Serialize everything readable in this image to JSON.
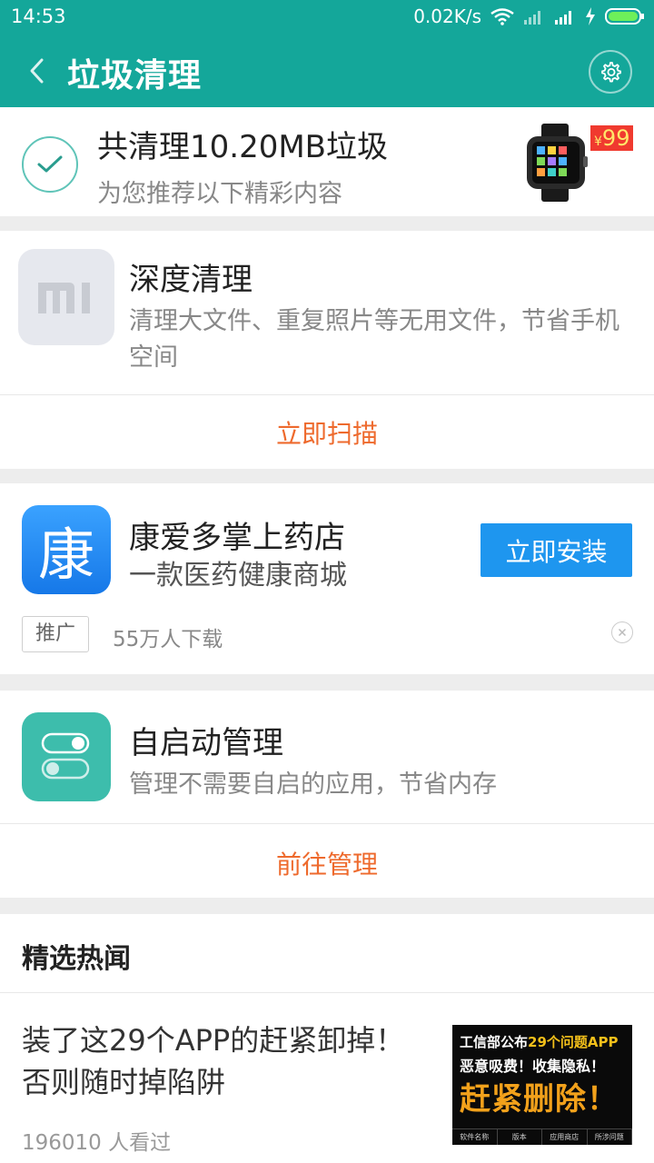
{
  "status_bar": {
    "time": "14:53",
    "net_speed": "0.02K/s"
  },
  "app_bar": {
    "title": "垃圾清理",
    "back_icon": "chevron-left-icon",
    "settings_icon": "gear-icon"
  },
  "summary": {
    "title": "共清理10.20MB垃圾",
    "subtitle": "为您推荐以下精彩内容",
    "ad_price_symbol": "¥",
    "ad_price": "99"
  },
  "deep_clean": {
    "title": "深度清理",
    "description": "清理大文件、重复照片等无用文件，节省手机空间",
    "action": "立即扫描"
  },
  "ad_app": {
    "icon_char": "康",
    "name": "康爱多掌上药店",
    "tagline": "一款医药健康商城",
    "install_label": "立即安装",
    "tag": "推广",
    "downloads": "55万人下载"
  },
  "autostart": {
    "title": "自启动管理",
    "description": "管理不需要自启的应用，节省内存",
    "action": "前往管理"
  },
  "news": {
    "section_title": "精选热闻",
    "item_title": "装了这29个APP的赶紧卸掉！否则随时掉陷阱",
    "item_views": "196010 人看过",
    "thumb_line1_a": "工信部公布",
    "thumb_line1_b": "29个问题APP",
    "thumb_line2": "恶意吸费！收集隐私！",
    "thumb_line3": "赶紧删除！",
    "thumb_footer": [
      "软件名称",
      "版本",
      "应用商店",
      "所涉问题"
    ]
  },
  "colors": {
    "brand": "#14a79a",
    "accent_orange": "#ee6a2d",
    "install_blue": "#1e96ef"
  }
}
